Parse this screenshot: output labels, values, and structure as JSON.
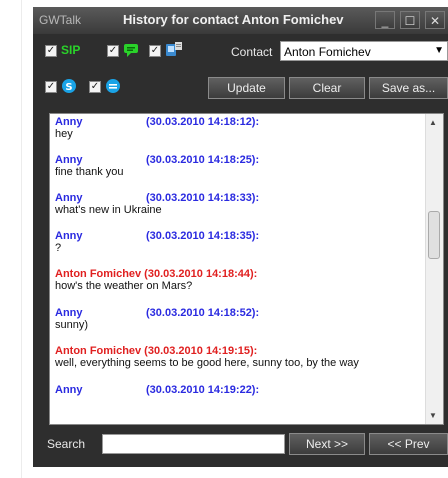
{
  "window": {
    "app_name": "GWTalk",
    "title": "History for contact Anton Fomichev",
    "min": "_",
    "max": "☐",
    "close": "✕"
  },
  "filters": {
    "sip_label": "SIP"
  },
  "contact": {
    "label": "Contact",
    "value": "Anton Fomichev"
  },
  "buttons": {
    "update": "Update",
    "clear": "Clear",
    "save": "Save as..."
  },
  "messages": [
    {
      "sender": "Anny",
      "time": "(30.03.2010 14:18:12):",
      "text": "hey",
      "color": "blue"
    },
    {
      "sender": "Anny",
      "time": "(30.03.2010 14:18:25):",
      "text": "fine thank you",
      "color": "blue"
    },
    {
      "sender": "Anny",
      "time": "(30.03.2010 14:18:33):",
      "text": "what's new in Ukraine",
      "color": "blue"
    },
    {
      "sender": "Anny",
      "time": "(30.03.2010 14:18:35):",
      "text": "?",
      "color": "blue"
    },
    {
      "sender": "Anton Fomichev",
      "time": "(30.03.2010 14:18:44):",
      "text": "how's the weather on Mars?",
      "color": "red"
    },
    {
      "sender": "Anny",
      "time": "(30.03.2010 14:18:52):",
      "text": "sunny)",
      "color": "blue"
    },
    {
      "sender": "Anton Fomichev",
      "time": "(30.03.2010 14:19:15):",
      "text": "well, everything seems to be good here, sunny too, by the way",
      "color": "red"
    },
    {
      "sender": "Anny",
      "time": "(30.03.2010 14:19:22):",
      "text": "",
      "color": "blue"
    }
  ],
  "search": {
    "label": "Search",
    "value": "",
    "next": "Next >>",
    "prev": "<< Prev"
  },
  "colors": {
    "blue": "#2a2ae0",
    "red": "#e02020",
    "window_bg": "#2e2e2e"
  }
}
